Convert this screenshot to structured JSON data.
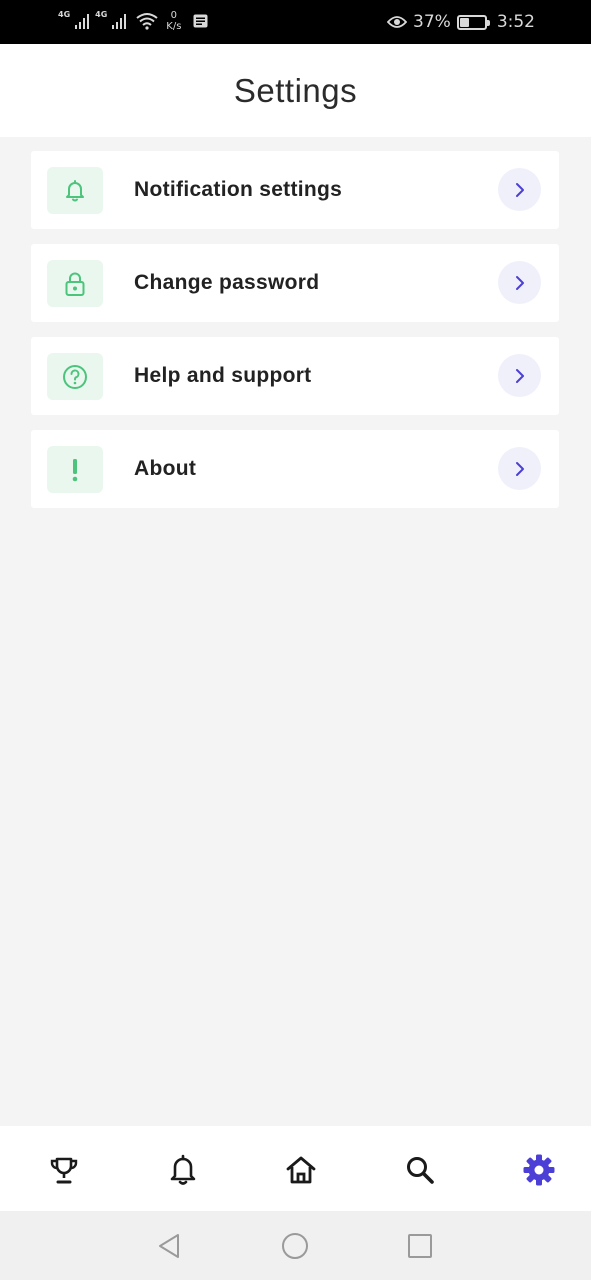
{
  "status_bar": {
    "net1": "4G",
    "net2": "4G",
    "speed_value": "0",
    "speed_unit": "K/s",
    "battery_percent": "37%",
    "battery_level": 0.37,
    "time": "3:52"
  },
  "header": {
    "title": "Settings"
  },
  "colors": {
    "accent": "#4b3fd6",
    "icon_green": "#4cc47c",
    "icon_bg": "#e9f7ee",
    "chevron_bg": "#f0f0fb"
  },
  "settings": {
    "items": [
      {
        "label": "Notification settings",
        "icon": "bell-icon"
      },
      {
        "label": "Change password",
        "icon": "lock-icon"
      },
      {
        "label": "Help and support",
        "icon": "help-circle-icon"
      },
      {
        "label": "About",
        "icon": "exclamation-icon"
      }
    ]
  },
  "bottom_nav": {
    "items": [
      {
        "icon": "trophy-icon",
        "active": false
      },
      {
        "icon": "bell-icon",
        "active": false
      },
      {
        "icon": "home-icon",
        "active": false
      },
      {
        "icon": "search-icon",
        "active": false
      },
      {
        "icon": "gear-icon",
        "active": true
      }
    ]
  },
  "system_nav": {
    "items": [
      {
        "icon": "back-triangle-icon"
      },
      {
        "icon": "home-circle-icon"
      },
      {
        "icon": "recents-square-icon"
      }
    ]
  }
}
